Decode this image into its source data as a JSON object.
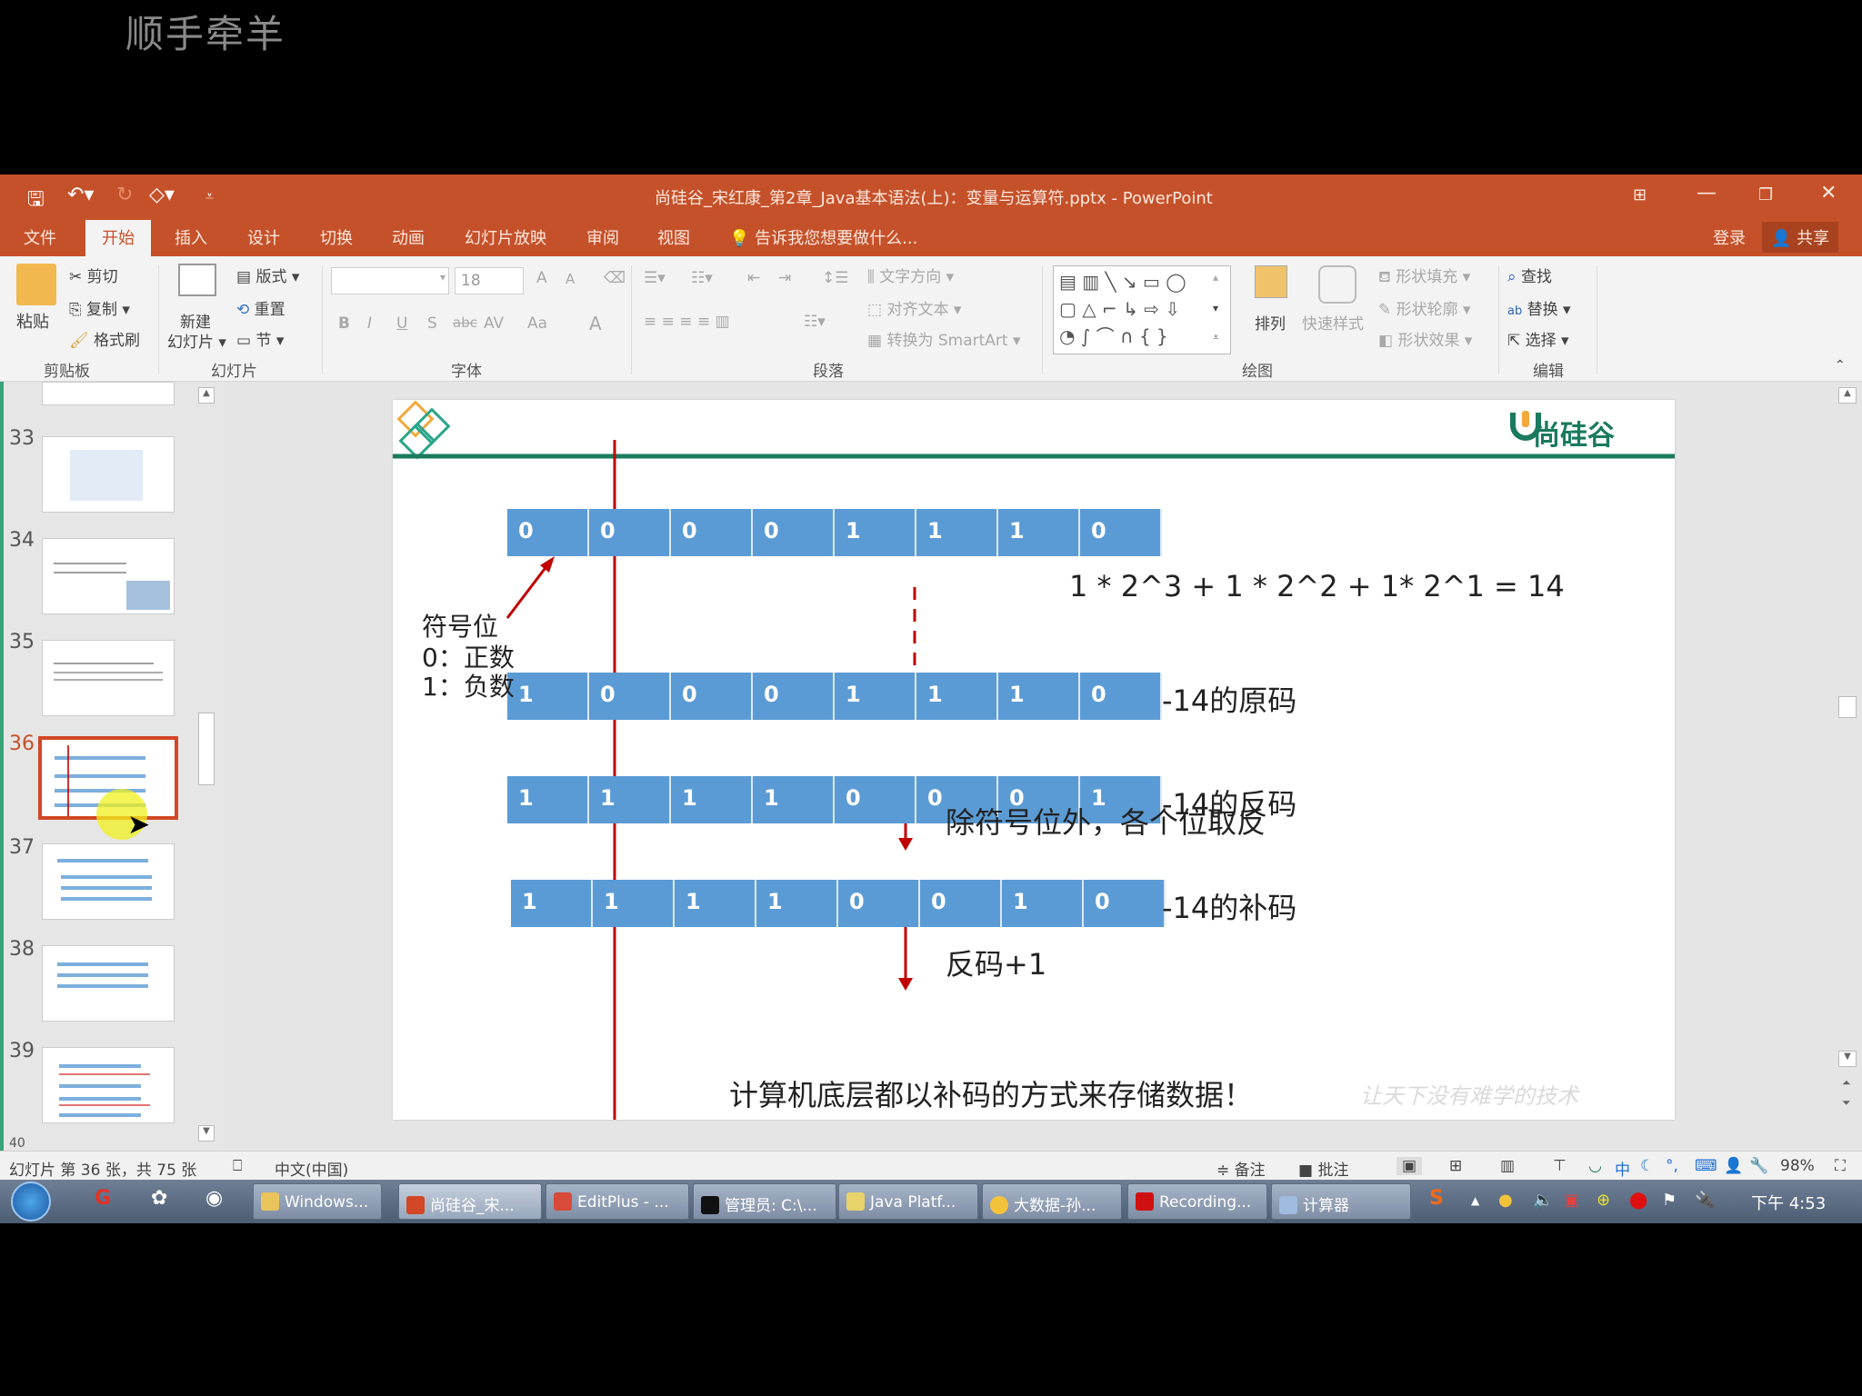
{
  "watermark": "顺手牵羊",
  "window": {
    "title": "尚硅谷_宋红康_第2章_Java基本语法(上)：变量与运算符.pptx - PowerPoint",
    "quick_access": [
      "save-icon",
      "undo-icon",
      "redo-icon",
      "touch-mode-icon",
      "customize-icon"
    ],
    "controls": [
      "ribbon-display-icon",
      "minimize-icon",
      "restore-icon",
      "close-icon"
    ]
  },
  "tabs": [
    {
      "label": "文件"
    },
    {
      "label": "开始",
      "active": true
    },
    {
      "label": "插入"
    },
    {
      "label": "设计"
    },
    {
      "label": "切换"
    },
    {
      "label": "动画"
    },
    {
      "label": "幻灯片放映"
    },
    {
      "label": "审阅"
    },
    {
      "label": "视图"
    }
  ],
  "tell_me": "告诉我您想要做什么...",
  "signin": "登录",
  "share": "共享",
  "ribbon": {
    "clipboard": {
      "paste": "粘贴",
      "cut": "剪切",
      "copy": "复制",
      "format_painter": "格式刷",
      "group": "剪贴板"
    },
    "slides": {
      "new_slide_1": "新建",
      "new_slide_2": "幻灯片",
      "layout": "版式",
      "reset": "重置",
      "section": "节",
      "group": "幻灯片"
    },
    "font": {
      "font_name": "",
      "font_size": "18",
      "bold": "B",
      "italic": "I",
      "underline": "U",
      "shadow": "S",
      "strike": "abc",
      "spacing": "AV",
      "case": "Aa",
      "color": "A",
      "grow": "A",
      "shrink": "A",
      "group": "字体"
    },
    "paragraph": {
      "text_direction": "文字方向",
      "align_text": "对齐文本",
      "smartart": "转换为 SmartArt",
      "group": "段落"
    },
    "drawing": {
      "arrange": "排列",
      "quick_styles": "快速样式",
      "shape_fill": "形状填充",
      "shape_outline": "形状轮廓",
      "shape_effects": "形状效果",
      "group": "绘图"
    },
    "editing": {
      "find": "查找",
      "replace": "替换",
      "select": "选择",
      "group": "编辑"
    }
  },
  "thumbnails": [
    {
      "num": "33"
    },
    {
      "num": "34"
    },
    {
      "num": "35"
    },
    {
      "num": "36",
      "selected": true
    },
    {
      "num": "37"
    },
    {
      "num": "38"
    },
    {
      "num": "39"
    },
    {
      "num": "40"
    }
  ],
  "slide": {
    "logo": "尚硅谷",
    "rows": [
      {
        "bits": [
          "0",
          "0",
          "0",
          "0",
          "1",
          "1",
          "1",
          "0"
        ],
        "label": ""
      },
      {
        "bits": [
          "1",
          "0",
          "0",
          "0",
          "1",
          "1",
          "1",
          "0"
        ],
        "label": "-14的原码"
      },
      {
        "bits": [
          "1",
          "1",
          "1",
          "1",
          "0",
          "0",
          "0",
          "1"
        ],
        "label": "-14的反码"
      },
      {
        "bits": [
          "1",
          "1",
          "1",
          "1",
          "0",
          "0",
          "1",
          "0"
        ],
        "label": "-14的补码"
      }
    ],
    "formula": "1 * 2^3 + 1 * 2^2 + 1* 2^1 = 14",
    "sign_bit": {
      "title": "符号位",
      "positive": "0：正数",
      "negative": "1：负数"
    },
    "step1": "除符号位外，各个位取反",
    "step2": "反码+1",
    "conclusion": "计算机底层都以补码的方式来存储数据！",
    "slogan": "让天下没有难学的技术",
    "colors": {
      "cell": "#5b9bd5",
      "accent_line": "#1a7a5e",
      "arrow": "#c00000"
    }
  },
  "status": {
    "slide_info": "幻灯片 第 36 张，共 75 张",
    "language": "中文(中国)",
    "notes": "备注",
    "comments": "批注",
    "zoom": "98%"
  },
  "taskbar": {
    "items": [
      "Windows...",
      "尚硅谷_宋...",
      "EditPlus - ...",
      "管理员: C:\\...",
      "Java Platf...",
      "大数据-孙...",
      "Recording...",
      "计算器"
    ],
    "clock": "下午 4:53"
  }
}
